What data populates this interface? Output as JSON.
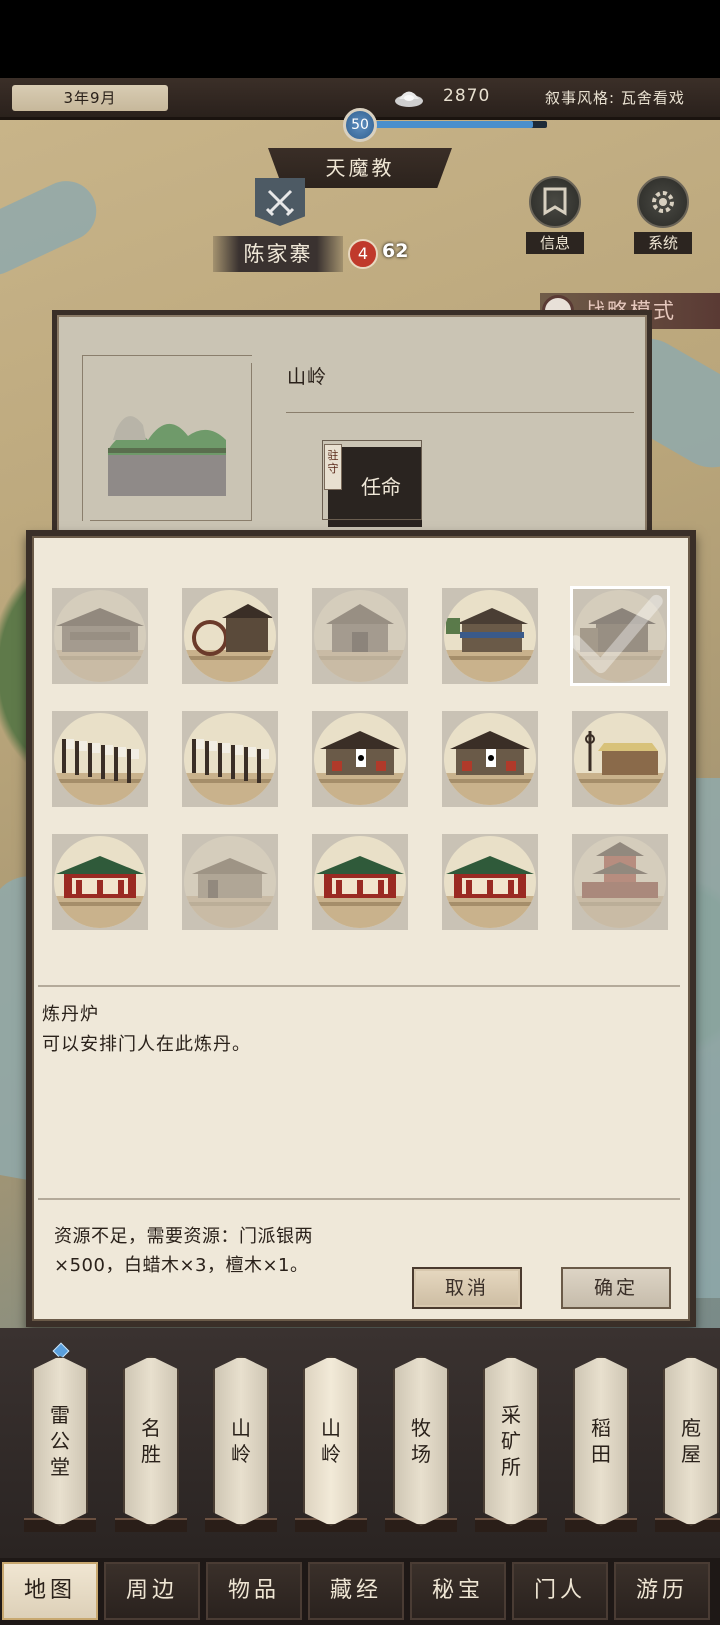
{
  "header": {
    "date": "3年9月",
    "silver": "2870",
    "narrative_style": "叙事风格: 瓦舍看戏",
    "level": "50",
    "xp_fraction": 0.92,
    "faction": "天魔教"
  },
  "map": {
    "village_name": "陈家寨",
    "red_badge": "4",
    "dark_badge": "62",
    "info_label": "信息",
    "system_label": "系统",
    "strategy_label": "战略模式"
  },
  "back_panel": {
    "title": "山岭",
    "garrison_tag": "驻守",
    "appoint_label": "任命"
  },
  "build_modal": {
    "selected_index": 4,
    "item_name": "炼丹炉",
    "item_desc": "可以安排门人在此炼丹。",
    "shortage_text": "资源不足，需要资源：门派银两×500，白蜡木×3，檀木×1。",
    "cancel_label": "取消",
    "confirm_label": "确定"
  },
  "buildings": [
    {
      "label": "雷公堂",
      "lines": [
        "雷",
        "公",
        "堂"
      ]
    },
    {
      "label": "名胜",
      "lines": [
        "名",
        "胜"
      ]
    },
    {
      "label": "山岭",
      "lines": [
        "山",
        "岭"
      ]
    },
    {
      "label": "山岭",
      "lines": [
        "山",
        "岭"
      ],
      "active": true
    },
    {
      "label": "牧场",
      "lines": [
        "牧",
        "场"
      ]
    },
    {
      "label": "采矿所",
      "lines": [
        "采",
        "矿",
        "所"
      ]
    },
    {
      "label": "稻田",
      "lines": [
        "稻",
        "田"
      ]
    },
    {
      "label": "庖屋",
      "lines": [
        "庖",
        "屋"
      ]
    }
  ],
  "nav": {
    "tabs": [
      "地图",
      "周边",
      "物品",
      "藏经",
      "秘宝",
      "门人",
      "游历"
    ],
    "active": 0
  }
}
